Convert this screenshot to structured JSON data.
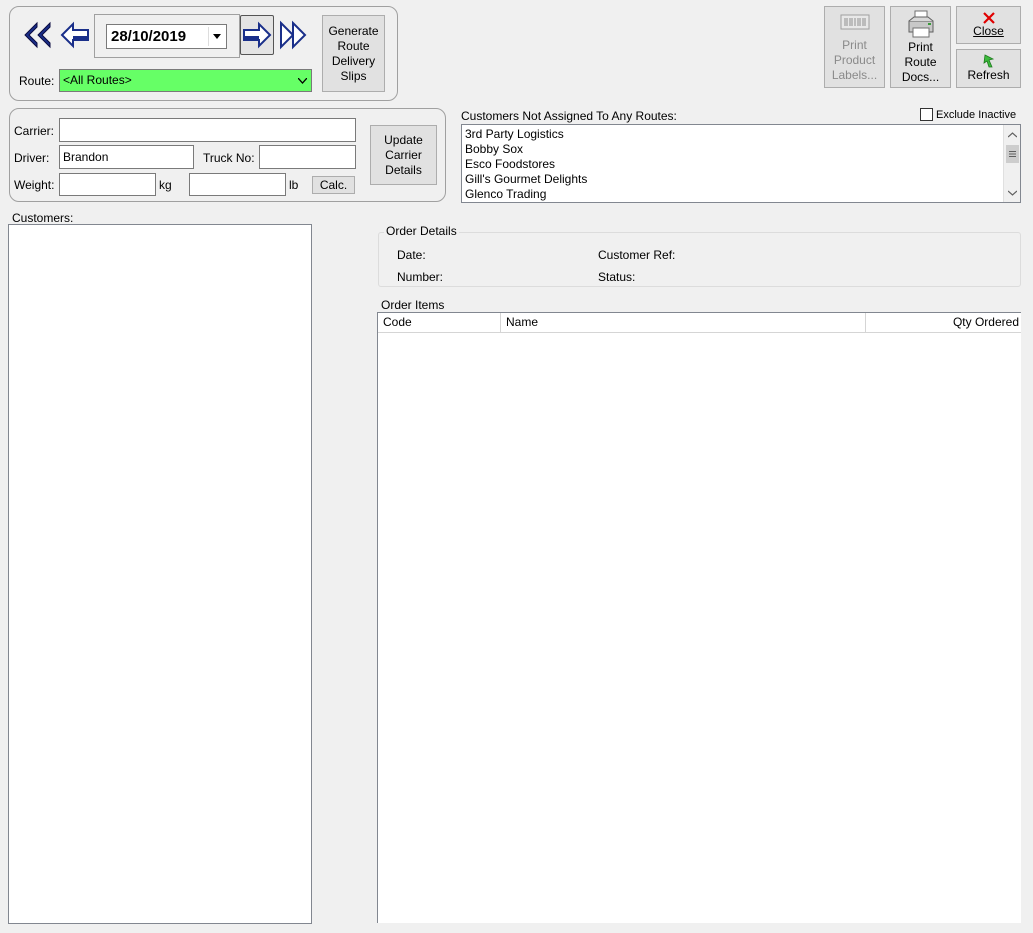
{
  "navigation": {
    "first_icon": "double-left-arrow-icon",
    "prev_icon": "left-arrow-icon",
    "date_value": "28/10/2019",
    "next_icon": "right-arrow-icon",
    "last_icon": "double-right-arrow-icon"
  },
  "generate_button": {
    "line1": "Generate",
    "line2": "Route",
    "line3": "Delivery",
    "line4": "Slips"
  },
  "route": {
    "label": "Route:",
    "value": "<All Routes>",
    "color": "#66ff66"
  },
  "toolbar": {
    "print_labels": {
      "line1": "Print",
      "line2": "Product",
      "line3": "Labels..."
    },
    "print_docs": {
      "line1": "Print",
      "line2": "Route",
      "line3": "Docs..."
    },
    "close": "Close",
    "refresh": "Refresh"
  },
  "carrier_panel": {
    "carrier_label": "Carrier:",
    "carrier_value": "",
    "driver_label": "Driver:",
    "driver_value": "Brandon",
    "truck_label": "Truck No:",
    "truck_value": "",
    "weight_label": "Weight:",
    "weight_kg_value": "",
    "kg_unit": "kg",
    "weight_lb_value": "",
    "lb_unit": "lb",
    "calc_button": "Calc.",
    "update_button": {
      "line1": "Update",
      "line2": "Carrier",
      "line3": "Details"
    }
  },
  "unassigned": {
    "title": "Customers Not Assigned To Any Routes:",
    "exclude_inactive_label": "Exclude Inactive",
    "exclude_inactive_checked": false,
    "items": [
      "3rd Party Logistics",
      "Bobby Sox",
      "Esco Foodstores",
      "Gill's Gourmet Delights",
      "Glenco Trading"
    ]
  },
  "customers": {
    "label": "Customers:"
  },
  "order_details": {
    "title": "Order Details",
    "date_label": "Date:",
    "number_label": "Number:",
    "customer_ref_label": "Customer Ref:",
    "status_label": "Status:"
  },
  "order_items": {
    "title": "Order Items",
    "columns": [
      "Code",
      "Name",
      "Qty Ordered"
    ]
  }
}
